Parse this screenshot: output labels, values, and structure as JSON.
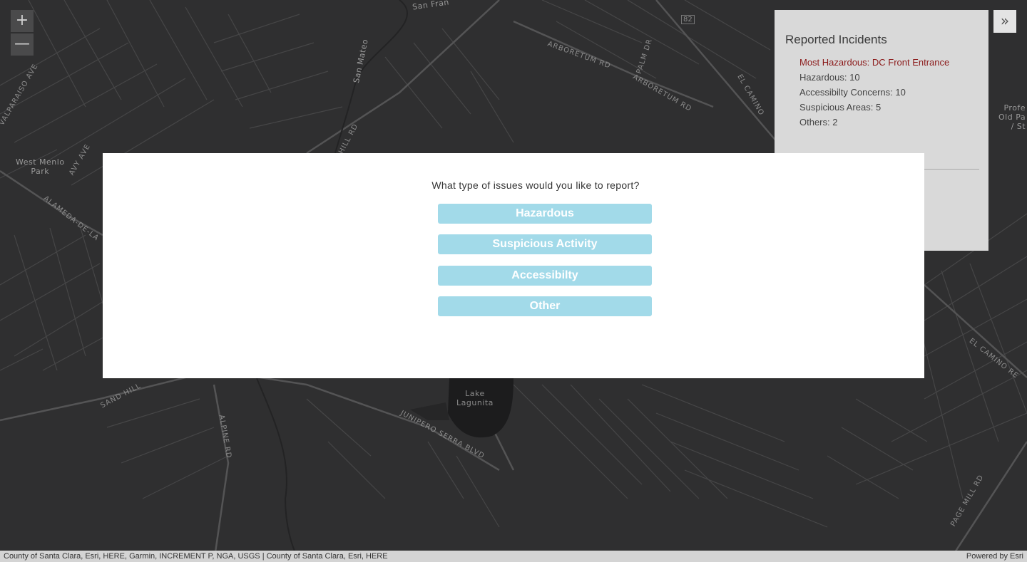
{
  "map": {
    "zoom_in_label": "+",
    "zoom_out_label": "—",
    "expand_label": "»",
    "place_labels": {
      "west_menlo_park": "West Menlo\nPark",
      "lake_lagunita": "Lake\nLagunita",
      "right_edge": "Profe\nOld Pa\n/ St",
      "san_francisquito": "San Fran",
      "san_mateo": "San Mateo"
    },
    "road_labels": {
      "valparaiso": "VALPARAISO AVE",
      "alameda": "ALAMEDA-DE-LA",
      "sand_hill_upper": "HILL RD",
      "sand_hill_lower": "SAND HILL",
      "arboretum_1": "ARBORETUM RD",
      "arboretum_2": "ARBORETUM RD",
      "palm_dr": "PALM DR",
      "el_camino_1": "EL CAMINO",
      "el_camino_2": "EL CAMINO RE",
      "junipero": "JUNIPERO SERRA BLVD",
      "alpine": "ALPINE RD",
      "page_mill": "PAGE MILL RD",
      "route_82": "82",
      "avy": "AVY AVE"
    }
  },
  "panel": {
    "title": "Reported Incidents",
    "most_hazardous": "Most Hazardous: DC Front Entrance",
    "hazardous": "Hazardous: 10",
    "accessibility": "Accessibilty Concerns: 10",
    "suspicious": "Suspicious Areas: 5",
    "others": "Others: 2"
  },
  "modal": {
    "question": "What type of issues would you like to report?",
    "buttons": {
      "hazardous": "Hazardous",
      "suspicious": "Suspicious Activity",
      "accessibility": "Accessibilty",
      "other": "Other"
    }
  },
  "attribution": {
    "sources": "County of Santa Clara, Esri, HERE, Garmin, INCREMENT P, NGA, USGS | County of Santa Clara, Esri, HERE",
    "powered_by": "Powered by Esri"
  },
  "colors": {
    "map_background": "#2f2f30",
    "road": "#4b4b4c",
    "major_road": "#5a5a5b",
    "water": "#1c1c1d",
    "button": "#a2dae9",
    "highlight": "#8b1a1a"
  }
}
